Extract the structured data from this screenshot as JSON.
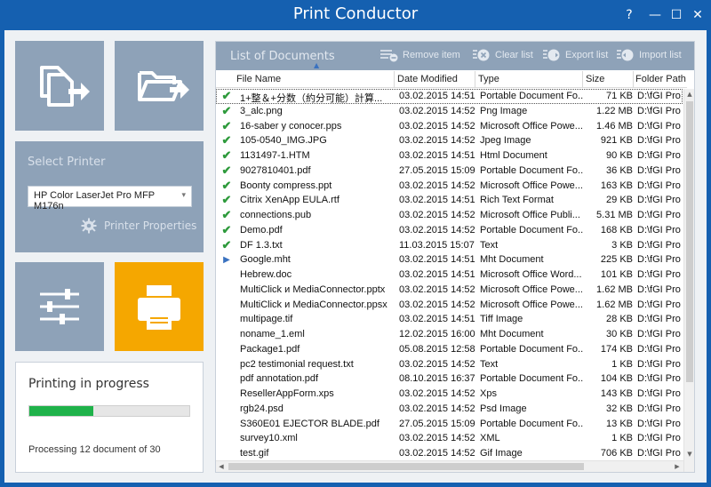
{
  "window": {
    "title": "Print Conductor",
    "help": "?",
    "minimize": "—",
    "maximize": "☐",
    "close": "✕"
  },
  "icons": {
    "add_files": "add-files-icon",
    "add_folder": "add-folder-icon",
    "settings": "sliders-icon",
    "print": "printer-icon"
  },
  "printer": {
    "label": "Select Printer",
    "selected": "HP Color LaserJet Pro MFP M176n",
    "properties_label": "Printer Properties"
  },
  "progress": {
    "title": "Printing in progress",
    "value": 0.4,
    "status": "Processing 12 document of 30"
  },
  "list": {
    "title": "List of Documents",
    "buttons": {
      "remove": "Remove item",
      "clear": "Clear list",
      "export": "Export list",
      "import": "Import list"
    },
    "columns": {
      "name": "File Name",
      "date": "Date Modified",
      "type": "Type",
      "size": "Size",
      "path": "Folder Path"
    },
    "rows": [
      {
        "mark": "check",
        "name": "1+整＆+分数（約分可能）計算...",
        "date": "03.02.2015 14:51",
        "type": "Portable Document Fo...",
        "size": "71 KB",
        "path": "D:\\fGI Pro"
      },
      {
        "mark": "check",
        "name": "3_alc.png",
        "date": "03.02.2015 14:52",
        "type": "Png Image",
        "size": "1.22 MB",
        "path": "D:\\fGI Pro"
      },
      {
        "mark": "check",
        "name": "16-saber y conocer.pps",
        "date": "03.02.2015 14:52",
        "type": "Microsoft Office Powe...",
        "size": "1.46 MB",
        "path": "D:\\fGI Pro"
      },
      {
        "mark": "check",
        "name": "105-0540_IMG.JPG",
        "date": "03.02.2015 14:52",
        "type": "Jpeg Image",
        "size": "921 KB",
        "path": "D:\\fGI Pro"
      },
      {
        "mark": "check",
        "name": "1131497-1.HTM",
        "date": "03.02.2015 14:51",
        "type": "Html Document",
        "size": "90 KB",
        "path": "D:\\fGI Pro"
      },
      {
        "mark": "check",
        "name": "9027810401.pdf",
        "date": "27.05.2015 15:09",
        "type": "Portable Document Fo...",
        "size": "36 KB",
        "path": "D:\\fGI Pro"
      },
      {
        "mark": "check",
        "name": "Boonty compress.ppt",
        "date": "03.02.2015 14:52",
        "type": "Microsoft Office Powe...",
        "size": "163 KB",
        "path": "D:\\fGI Pro"
      },
      {
        "mark": "check",
        "name": "Citrix XenApp EULA.rtf",
        "date": "03.02.2015 14:51",
        "type": "Rich Text Format",
        "size": "29 KB",
        "path": "D:\\fGI Pro"
      },
      {
        "mark": "check",
        "name": "connections.pub",
        "date": "03.02.2015 14:52",
        "type": "Microsoft Office Publi...",
        "size": "5.31 MB",
        "path": "D:\\fGI Pro"
      },
      {
        "mark": "check",
        "name": "Demo.pdf",
        "date": "03.02.2015 14:52",
        "type": "Portable Document Fo...",
        "size": "168 KB",
        "path": "D:\\fGI Pro"
      },
      {
        "mark": "check",
        "name": "DF 1.3.txt",
        "date": "11.03.2015 15:07",
        "type": "Text",
        "size": "3 KB",
        "path": "D:\\fGI Pro"
      },
      {
        "mark": "arrow",
        "name": "Google.mht",
        "date": "03.02.2015 14:51",
        "type": "Mht Document",
        "size": "225 KB",
        "path": "D:\\fGI Pro"
      },
      {
        "mark": "",
        "name": "Hebrew.doc",
        "date": "03.02.2015 14:51",
        "type": "Microsoft Office Word...",
        "size": "101 KB",
        "path": "D:\\fGI Pro"
      },
      {
        "mark": "",
        "name": "MultiClick и MediaConnector.pptx",
        "date": "03.02.2015 14:52",
        "type": "Microsoft Office Powe...",
        "size": "1.62 MB",
        "path": "D:\\fGI Pro"
      },
      {
        "mark": "",
        "name": "MultiClick и MediaConnector.ppsx",
        "date": "03.02.2015 14:52",
        "type": "Microsoft Office Powe...",
        "size": "1.62 MB",
        "path": "D:\\fGI Pro"
      },
      {
        "mark": "",
        "name": "multipage.tif",
        "date": "03.02.2015 14:51",
        "type": "Tiff Image",
        "size": "28 KB",
        "path": "D:\\fGI Pro"
      },
      {
        "mark": "",
        "name": "noname_1.eml",
        "date": "12.02.2015 16:00",
        "type": "Mht Document",
        "size": "30 KB",
        "path": "D:\\fGI Pro"
      },
      {
        "mark": "",
        "name": "Package1.pdf",
        "date": "05.08.2015 12:58",
        "type": "Portable Document Fo...",
        "size": "174 KB",
        "path": "D:\\fGI Pro"
      },
      {
        "mark": "",
        "name": "pc2 testimonial request.txt",
        "date": "03.02.2015 14:52",
        "type": "Text",
        "size": "1 KB",
        "path": "D:\\fGI Pro"
      },
      {
        "mark": "",
        "name": "pdf annotation.pdf",
        "date": "08.10.2015 16:37",
        "type": "Portable Document Fo...",
        "size": "104 KB",
        "path": "D:\\fGI Pro"
      },
      {
        "mark": "",
        "name": "ResellerAppForm.xps",
        "date": "03.02.2015 14:52",
        "type": "Xps",
        "size": "143 KB",
        "path": "D:\\fGI Pro"
      },
      {
        "mark": "",
        "name": "rgb24.psd",
        "date": "03.02.2015 14:52",
        "type": "Psd Image",
        "size": "32 KB",
        "path": "D:\\fGI Pro"
      },
      {
        "mark": "",
        "name": "S360E01 EJECTOR BLADE.pdf",
        "date": "27.05.2015 15:09",
        "type": "Portable Document Fo...",
        "size": "13 KB",
        "path": "D:\\fGI Pro"
      },
      {
        "mark": "",
        "name": "survey10.xml",
        "date": "03.02.2015 14:52",
        "type": "XML",
        "size": "1 KB",
        "path": "D:\\fGI Pro"
      },
      {
        "mark": "",
        "name": "test.gif",
        "date": "03.02.2015 14:52",
        "type": "Gif Image",
        "size": "706 KB",
        "path": "D:\\fGI Pro"
      }
    ]
  }
}
